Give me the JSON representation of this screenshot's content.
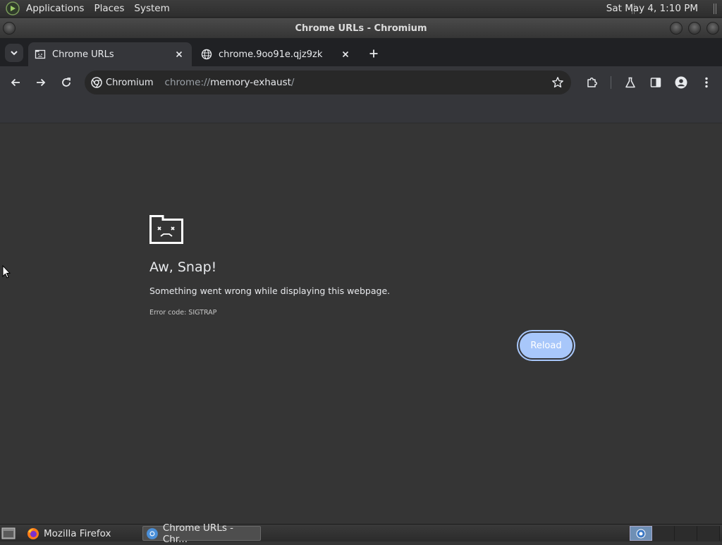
{
  "top_panel": {
    "menus": [
      "Applications",
      "Places",
      "System"
    ],
    "clock": "Sat May  4,  1:10 PM"
  },
  "window": {
    "title": "Chrome URLs - Chromium"
  },
  "tabs": [
    {
      "title": "Chrome URLs",
      "active": true,
      "icon": "sad-page-icon"
    },
    {
      "title": "chrome.9oo91e.qjz9zk",
      "active": false,
      "icon": "globe-icon"
    }
  ],
  "omnibox": {
    "site_chip": "Chromium",
    "scheme": "chrome://",
    "host": "memory-exhaust",
    "path": "/"
  },
  "error_page": {
    "heading": "Aw, Snap!",
    "message": "Something went wrong while displaying this webpage.",
    "code": "Error code: SIGTRAP",
    "reload_label": "Reload"
  },
  "taskbar": {
    "tasks": [
      {
        "label": "Mozilla Firefox",
        "icon": "firefox-icon"
      },
      {
        "label": "Chrome URLs - Chr...",
        "icon": "chromium-icon",
        "active": true
      }
    ]
  },
  "colors": {
    "accent": "#a8c7fa",
    "page_background": "#353535",
    "toolbar": "#35363a",
    "tabstrip": "#202124"
  }
}
